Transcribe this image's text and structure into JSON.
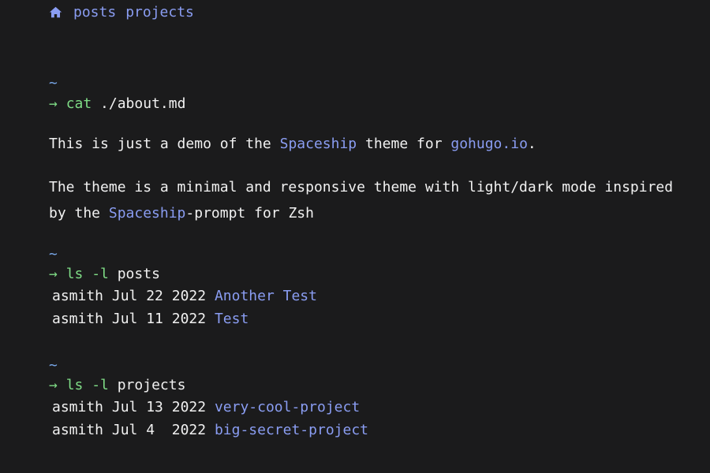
{
  "nav": {
    "home_icon": "home-icon",
    "links": [
      "posts",
      "projects"
    ]
  },
  "sections": {
    "about": {
      "tilde": "~",
      "arrow": "→",
      "command": "cat",
      "argument": "./about.md",
      "p1": {
        "before": "This is just a demo of the ",
        "link1": "Spaceship",
        "middle": " theme for ",
        "link2": "gohugo.io",
        "after": "."
      },
      "p2": {
        "line1": "The theme is a minimal and responsive theme with light/dark mode inspired",
        "line2_before": "by the ",
        "line2_link": "Spaceship",
        "line2_after": "-prompt for Zsh"
      }
    },
    "posts": {
      "tilde": "~",
      "arrow": "→",
      "command": "ls -l",
      "argument": "posts",
      "rows": [
        {
          "owner": "asmith",
          "date": "Jul 22 2022",
          "title": "Another Test"
        },
        {
          "owner": "asmith",
          "date": "Jul 11 2022",
          "title": "Test"
        }
      ]
    },
    "projects": {
      "tilde": "~",
      "arrow": "→",
      "command": "ls -l",
      "argument": "projects",
      "rows": [
        {
          "owner": "asmith",
          "date": "Jul 13 2022",
          "title": "very-cool-project"
        },
        {
          "owner": "asmith",
          "date": "Jul 4  2022",
          "title": "big-secret-project"
        }
      ]
    }
  },
  "colors": {
    "background": "#1b1b1c",
    "text": "#f1f1f1",
    "link": "#8a9df2",
    "prompt_green": "#7fdc86",
    "tilde_blue": "#78a7e8"
  }
}
